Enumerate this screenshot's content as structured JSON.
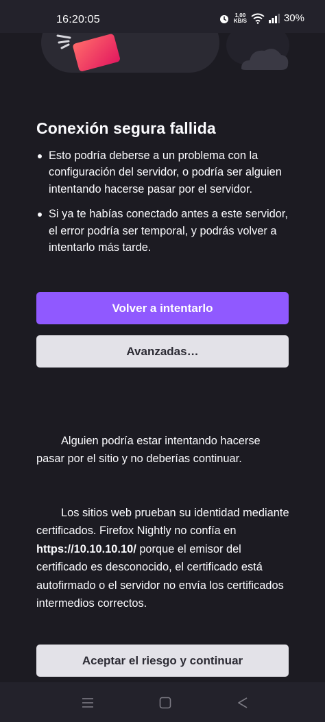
{
  "status_bar": {
    "time": "16:20:05",
    "net_speed_value": "1,00",
    "net_speed_unit": "KB/S",
    "battery": "30%",
    "icons": [
      "alarm-icon",
      "wifi-icon",
      "signal-icon",
      "battery-icon"
    ]
  },
  "error_page": {
    "title": "Conexión segura fallida",
    "bullets": [
      "Esto podría deberse a un problema con la configuración del servidor, o podría ser alguien intentando hacerse pasar por el servidor.",
      "Si ya te habías conectado antes a este servidor, el error podría ser temporal, y podrás volver a intentarlo más tarde."
    ],
    "retry_label": "Volver a intentarlo",
    "advanced_label": "Avanzadas…"
  },
  "advanced": {
    "warning_text": "Alguien podría estar intentando hacerse pasar por el sitio y no deberías continuar.",
    "cert_text_before": "Los sitios web prueban su identidad mediante certificados. Firefox Nightly no confía en ",
    "cert_host": "https://10.10.10.10/",
    "cert_text_after": " porque el emisor del certificado es desconocido, el certificado está autofirmado o el servidor no envía los certificados intermedios correctos.",
    "accept_label": "Aceptar el riesgo y continuar"
  },
  "nav_bar": {
    "icons": [
      "menu-icon",
      "home-icon",
      "back-icon"
    ]
  },
  "colors": {
    "background": "#1c1b22",
    "primary_button": "#9059ff",
    "secondary_button": "#e3e2e8"
  }
}
